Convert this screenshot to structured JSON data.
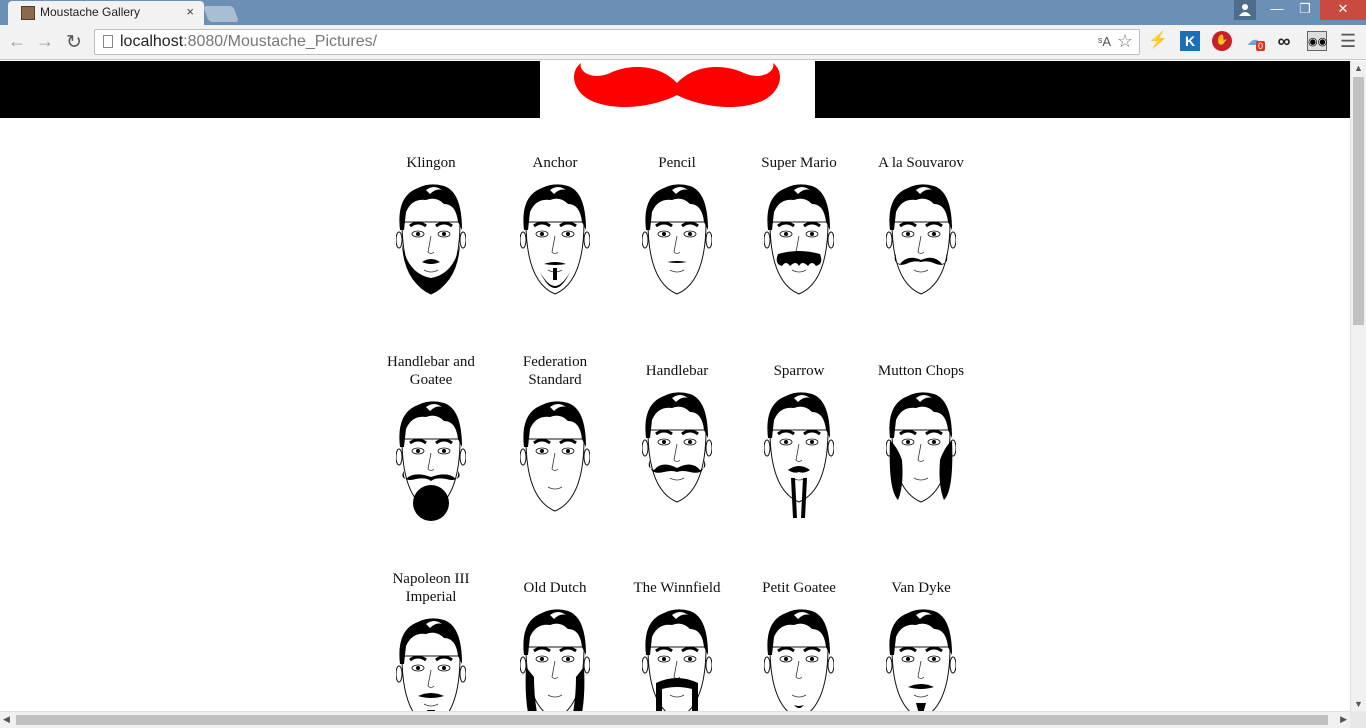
{
  "browser": {
    "tab_title": "Moustache Gallery",
    "tab_close": "×",
    "url_host": "localhost",
    "url_path": ":8080/Moustache_Pictures/",
    "icons": [
      "back-icon",
      "forward-icon",
      "reload-icon",
      "page-icon",
      "translate-icon",
      "star-icon",
      "bolt-extension-icon",
      "k-extension-icon",
      "stop-extension-icon",
      "cloud-extension-icon",
      "infinity-extension-icon",
      "glasses-extension-icon",
      "menu-icon"
    ],
    "cloud_badge": "0",
    "ext_k_label": "K",
    "ext_inf_label": "∞"
  },
  "window": {
    "min": "—",
    "max": "❐",
    "close": "✕"
  },
  "banner": {
    "logo": "moustache-logo",
    "logo_color": "#ff0000",
    "background": "#000000"
  },
  "gallery": {
    "rows": [
      [
        {
          "caption": "Klingon",
          "style": "klingon"
        },
        {
          "caption": "Anchor",
          "style": "anchor"
        },
        {
          "caption": "Pencil",
          "style": "pencil"
        },
        {
          "caption": "Super Mario",
          "style": "mario"
        },
        {
          "caption": "A la Souvarov",
          "style": "souvarov"
        }
      ],
      [
        {
          "caption": "Handlebar and Goatee",
          "style": "handlebar-goatee"
        },
        {
          "caption": "Federation Standard",
          "style": "none"
        },
        {
          "caption": "Handlebar",
          "style": "handlebar"
        },
        {
          "caption": "Sparrow",
          "style": "sparrow"
        },
        {
          "caption": "Mutton Chops",
          "style": "mutton"
        }
      ],
      [
        {
          "caption": "Napoleon III Imperial",
          "style": "napoleon"
        },
        {
          "caption": "Old Dutch",
          "style": "dutch"
        },
        {
          "caption": "The Winnfield",
          "style": "winnfield"
        },
        {
          "caption": "Petit Goatee",
          "style": "petit"
        },
        {
          "caption": "Van Dyke",
          "style": "vandyke"
        }
      ]
    ]
  }
}
